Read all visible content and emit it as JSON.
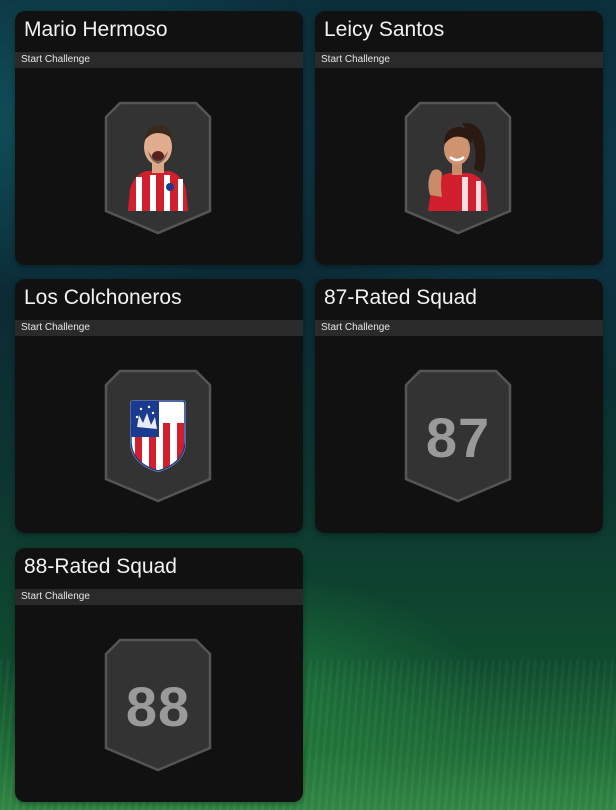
{
  "challenges": [
    {
      "title": "Mario Hermoso",
      "action": "Start Challenge",
      "image": "player-portrait-icon"
    },
    {
      "title": "Leicy Santos",
      "action": "Start Challenge",
      "image": "player-portrait-icon"
    },
    {
      "title": "Los Colchoneros",
      "action": "Start Challenge",
      "image": "atletico-crest-icon"
    },
    {
      "title": "87-Rated Squad",
      "action": "Start Challenge",
      "rating": "87"
    },
    {
      "title": "88-Rated Squad",
      "action": "Start Challenge",
      "rating": "88"
    }
  ],
  "colors": {
    "card_bg": "#111111",
    "subtitle_bar": "#2a2a2a",
    "shield_fill": "#333333",
    "shield_border": "#555555",
    "rating_text": "#9a9a9a",
    "kit_red": "#d11f2e"
  }
}
